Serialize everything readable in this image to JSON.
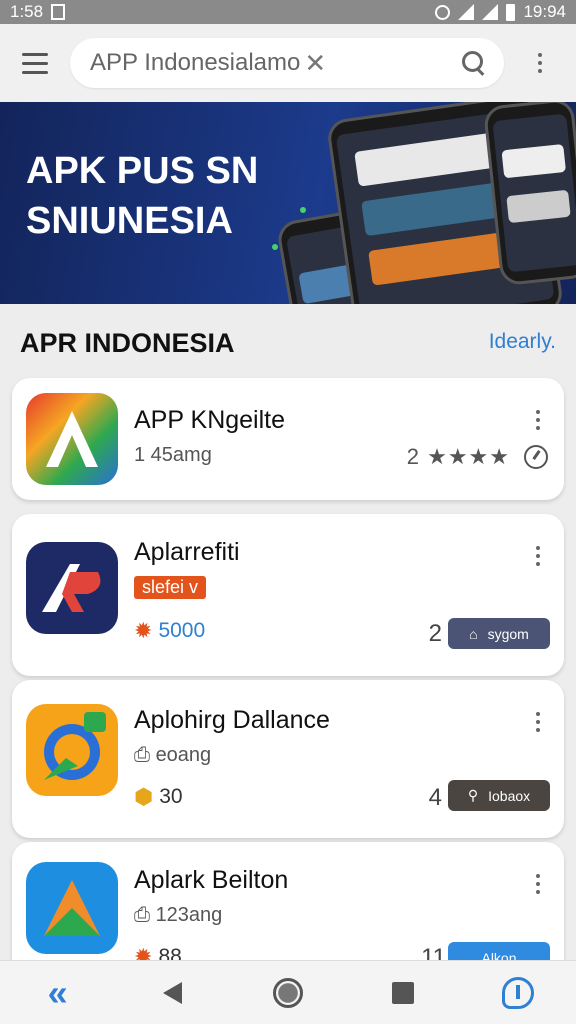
{
  "status_bar": {
    "time": "1:58",
    "clock_right": "19:94"
  },
  "app_bar": {
    "menu_icon": "hamburger-menu-icon",
    "search_value": "APP Indonesialamo",
    "clear_icon_glyph": "✕",
    "search_icon": "search-icon",
    "more_icon": "more-vertical-icon"
  },
  "banner": {
    "title_line1": "APK PUS SN",
    "title_line2": "SNIUNESIA"
  },
  "section": {
    "title": "APR INDONESIA",
    "link": "Idearly."
  },
  "apps": [
    {
      "name": "APP KNgeilte",
      "size": "1 45amg",
      "rating_num": "2",
      "stars": "★★★★",
      "icon_colors": [
        "#e63b2e",
        "#f5a623",
        "#2ea84f",
        "#2a6fd6"
      ]
    },
    {
      "name": "Aplarrefiti",
      "badge": "slefei v",
      "count": "5000",
      "right_num": "2",
      "action_label": "sygom",
      "action_color": "#4b5474"
    },
    {
      "name": "Aplohirg Dallance",
      "size": "eoang",
      "count": "30",
      "right_num": "4",
      "action_label": "Iobaox",
      "action_color": "#4a4540"
    },
    {
      "name": "Aplark Beilton",
      "size": "123ang",
      "count": "88",
      "right_num": "11",
      "action_label": "Alkon",
      "action_color": "#2f8be0"
    }
  ],
  "nav": {
    "back_glyph": "«"
  },
  "colors": {
    "accent": "#2f7fd3",
    "banner_bg": "#1c3b8c",
    "badge": "#e2541c"
  }
}
